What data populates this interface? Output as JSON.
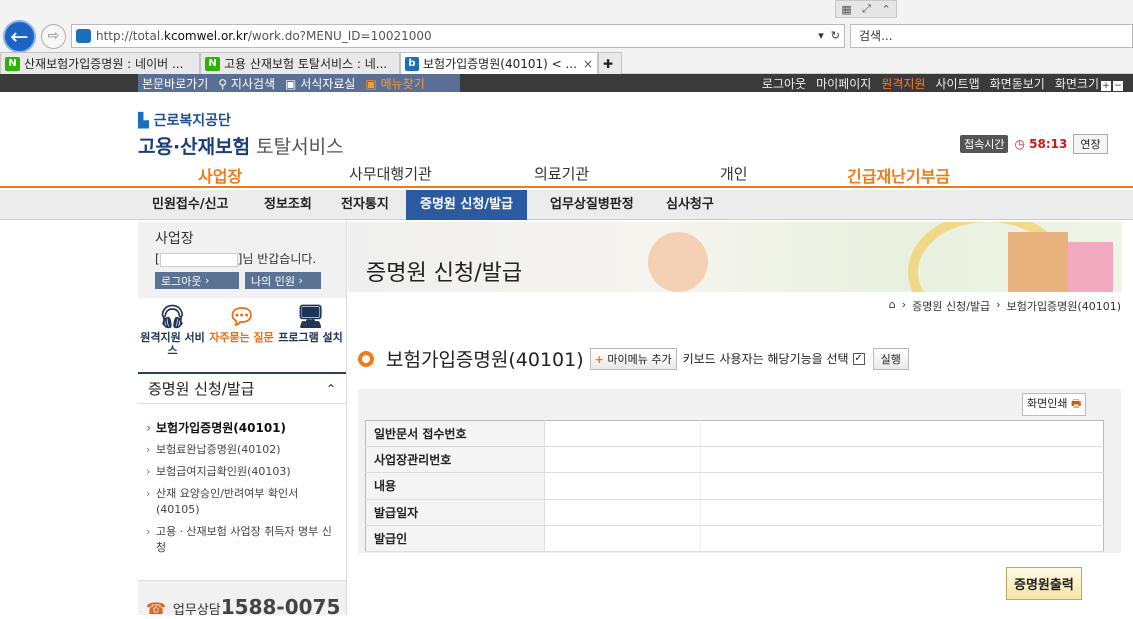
{
  "browser": {
    "url_prefix": "http://total.",
    "url_host": "kcomwel.or.kr",
    "url_path": "/work.do?MENU_ID=10021000",
    "search_placeholder": "검색...",
    "tabs": [
      {
        "label": "산재보험가입증명원 : 네이버 ...",
        "icon": "naver-icon",
        "active": false
      },
      {
        "label": "고용 산재보험 토탈서비스 : 네...",
        "icon": "naver-icon",
        "active": false
      },
      {
        "label": "보험가입증명원(40101) < ...",
        "icon": "kcomwel-icon",
        "active": true
      }
    ]
  },
  "topbar": {
    "skip_links": [
      "본문바로가기",
      "지사검색",
      "서식자료실",
      "메뉴찾기"
    ],
    "util_links": [
      "로그아웃",
      "마이페이지",
      "원격지원",
      "사이트맵",
      "화면돋보기",
      "화면크기"
    ]
  },
  "header": {
    "brand": "근로복지공단",
    "service_bold": "고용·산재보험",
    "service_rest": "토탈서비스",
    "session_label": "접속시간",
    "session_time": "58:13",
    "extend_label": "연장"
  },
  "gnb": [
    "사업장",
    "사무대행기관",
    "의료기관",
    "개인",
    "긴급재난기부금"
  ],
  "subnav": [
    "민원접수/신고",
    "정보조회",
    "전자통지",
    "증명원 신청/발급",
    "업무상질병판정",
    "심사청구"
  ],
  "left": {
    "user_title": "사업장",
    "greeting_prefix": "[",
    "greeting_suffix": "]님 반갑습니다.",
    "logout": "로그아웃",
    "my_civil": "나의 민원",
    "quick": [
      {
        "label": "원격지원 서비스",
        "icon": "headset-icon"
      },
      {
        "label": "자주묻는 질문",
        "icon": "speech-bubble-icon"
      },
      {
        "label": "프로그램 설치",
        "icon": "monitor-icon"
      }
    ],
    "section_title": "증명원 신청/발급",
    "menu": [
      "보험가입증명원(40101)",
      "보험료완납증명원(40102)",
      "보험급여지급확인원(40103)",
      "산재 요양승인/반려여부 확인서 (40105)",
      "고용ㆍ산재보험 사업장 취득자 명부 신청"
    ],
    "phone_label": "업무상담",
    "phone": "1588-0075"
  },
  "banner": {
    "title": "증명원 신청/발급"
  },
  "breadcrumb": [
    "증명원 신청/발급",
    "보험가입증명원(40101)"
  ],
  "page": {
    "title": "보험가입증명원(40101)",
    "add_my_menu": "마이메뉴 추가",
    "keyboard_note": "키보드 사용자는 해당기능을 선택",
    "run": "실행",
    "print_screen": "화면인쇄",
    "rows": [
      "일반문서 접수번호",
      "사업장관리번호",
      "내용",
      "발급일자",
      "발급인"
    ],
    "issue_button": "증명원출력"
  },
  "colors": {
    "accent": "#f07b1a",
    "nav_active": "#2c5aa0",
    "session_time": "#d01818"
  }
}
